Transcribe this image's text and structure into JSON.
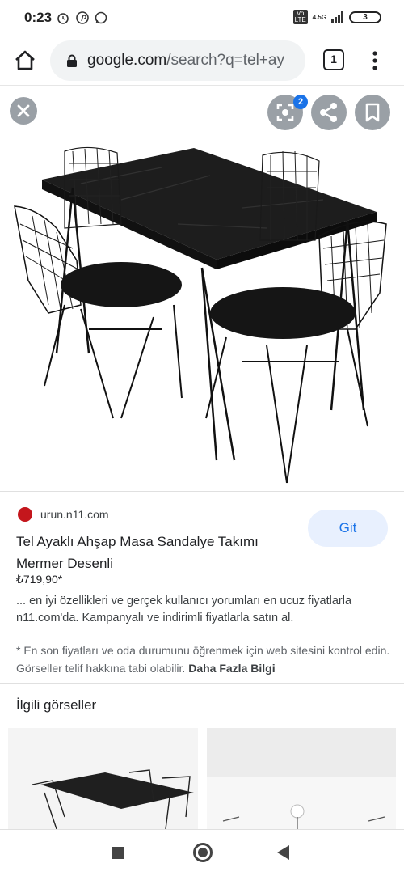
{
  "status": {
    "time": "0:23",
    "battery": "3",
    "network": "4.5G",
    "volte": "Vo LTE"
  },
  "browser": {
    "url_host": "google.com",
    "url_path": "/search?q=tel+ay",
    "tab_count": "1"
  },
  "viewer": {
    "lens_badge": "2"
  },
  "result": {
    "domain": "urun.n11.com",
    "visit_label": "Git",
    "title": "Tel Ayaklı Ahşap Masa Sandalye Takımı Mermer Desenli",
    "price": "₺719,90*",
    "snippet": "... en iyi özellikleri ve gerçek kullanıcı yorumları en ucuz fiyatlarla n11.com'da. Kampanyalı ve indirimli fiyatlarla satın al.",
    "notice": "* En son fiyatları ve oda durumunu öğrenmek için web sitesini kontrol edin. Görseller telif hakkına tabi olabilir.",
    "more_info": "Daha Fazla Bilgi"
  },
  "related": {
    "heading": "İlgili görseller"
  },
  "icons": {
    "home": "home-icon",
    "lock": "lock-icon",
    "menu": "more-vert-icon",
    "close": "close-icon",
    "lens": "lens-icon",
    "share": "share-icon",
    "bookmark": "bookmark-icon",
    "nav_recents": "square-icon",
    "nav_home": "circle-icon",
    "nav_back": "back-triangle-icon"
  },
  "colors": {
    "accent": "#1a73e8",
    "git_bg": "#e8f0fe",
    "icon_bg": "#9aa0a6"
  }
}
